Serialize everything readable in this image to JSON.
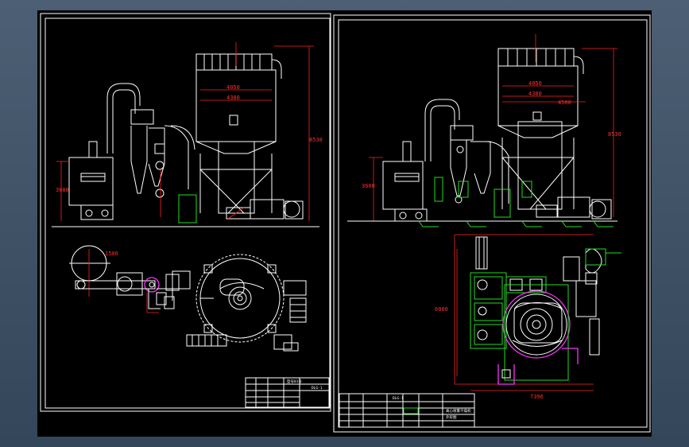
{
  "left_sheet": {
    "dims": {
      "d1": "4050",
      "d2": "4380",
      "height_right": "8530",
      "height_left": "3600",
      "plan_dia": "1500"
    },
    "title_block": {
      "ref": "型号01号",
      "code": "DLG-1"
    }
  },
  "right_sheet": {
    "dims": {
      "d1": "4050",
      "d2": "4380",
      "d3": "4500",
      "height_right": "8530",
      "height_left": "3600",
      "plan_width": "7396",
      "plan_height": "6000"
    },
    "title_block": {
      "code": "DLG-1",
      "name": "离心喷雾干燥机",
      "sub": "外形图"
    }
  },
  "colors": {
    "background": "#000000",
    "line": "#ffffff",
    "dimension": "#ff2020",
    "green": "#22dd22",
    "magenta": "#ff30ff"
  }
}
